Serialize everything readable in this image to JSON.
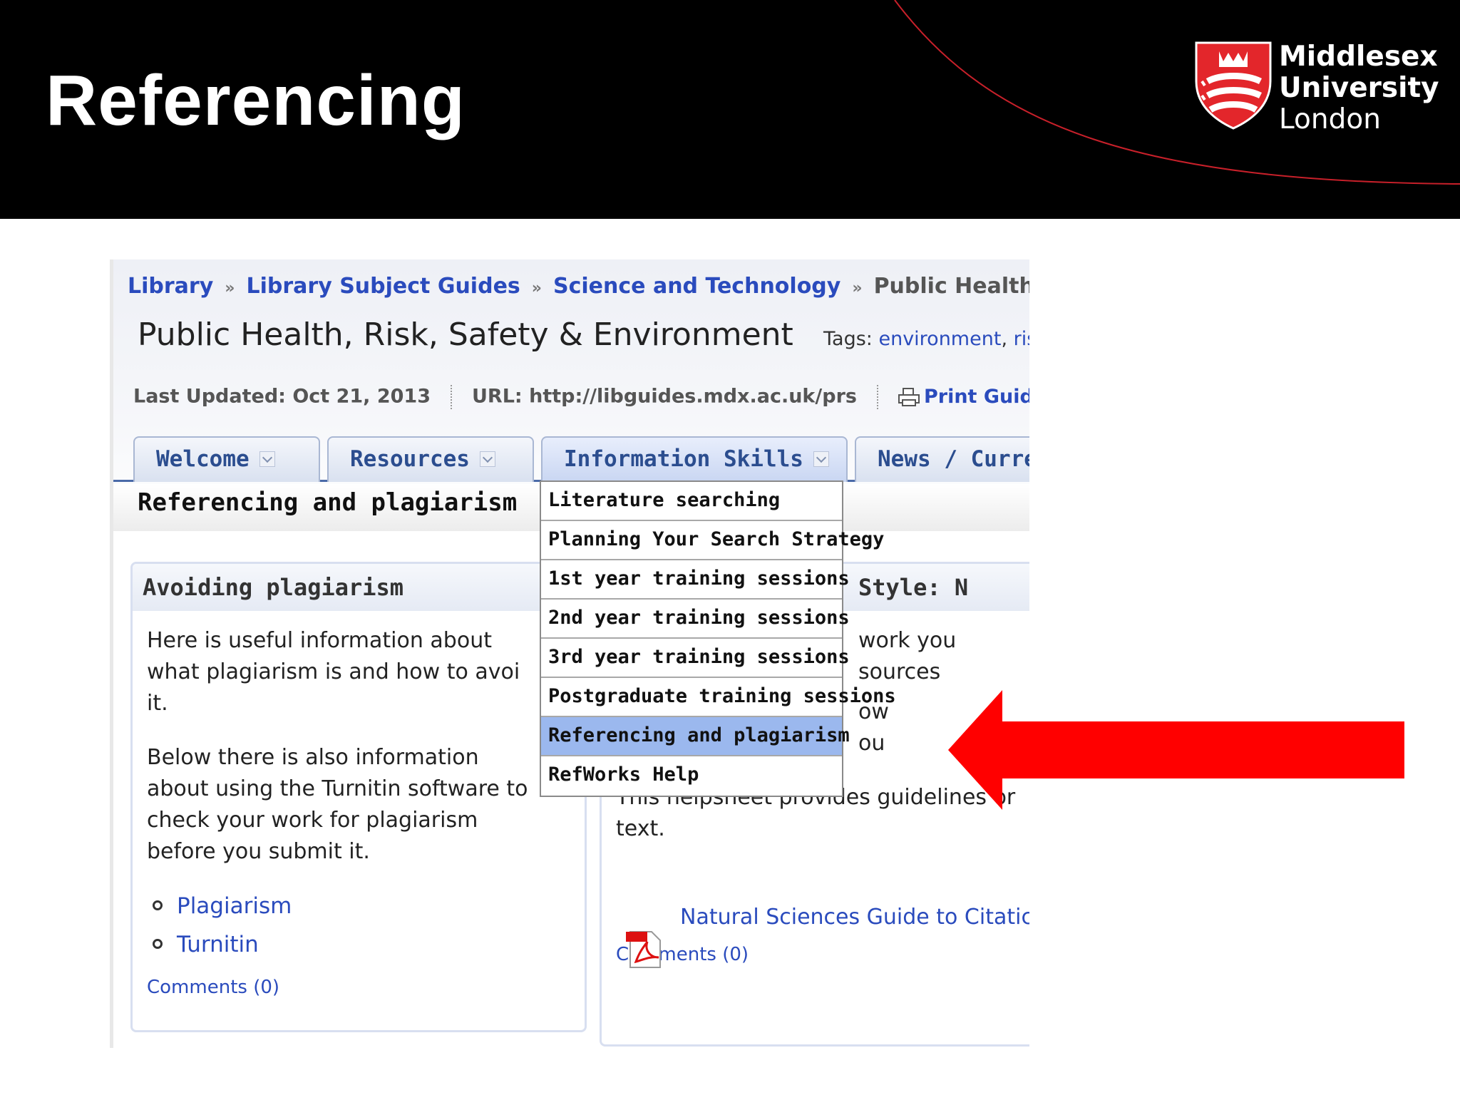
{
  "slide": {
    "title": "Referencing",
    "logo": {
      "line1": "Middlesex",
      "line2": "University",
      "line3": "London"
    }
  },
  "breadcrumb": {
    "items": [
      "Library",
      "Library Subject Guides",
      "Science and Technology"
    ],
    "current": "Public Health, Risk",
    "separator": "»"
  },
  "guide": {
    "title": "Public Health, Risk, Safety & Environment",
    "tags_label": "Tags:",
    "tags": [
      "environment",
      "ris"
    ]
  },
  "meta": {
    "last_updated": "Last Updated: Oct 21, 2013",
    "url": "URL: http://libguides.mdx.ac.uk/prs",
    "print": "Print Guide"
  },
  "tabs": [
    {
      "label": "Welcome"
    },
    {
      "label": "Resources"
    },
    {
      "label": "Information Skills"
    },
    {
      "label": "News / Curre"
    }
  ],
  "page_heading": "Referencing and plagiarism",
  "dropdown": {
    "items": [
      "Literature searching",
      "Planning Your Search Strategy",
      "1st year training sessions",
      "2nd year training sessions",
      "3rd year training sessions",
      "Postgraduate training sessions",
      "Referencing and plagiarism",
      "RefWorks Help"
    ],
    "selected": "Referencing and plagiarism"
  },
  "left_box": {
    "header": "Avoiding plagiarism",
    "para1": [
      "Here is useful information about",
      "what plagiarism is and how to avoi",
      "it."
    ],
    "para2": [
      "Below there is also information",
      "about using the Turnitin software to",
      "check your work for plagiarism",
      "before you submit it."
    ],
    "links": [
      "Plagiarism",
      "Turnitin"
    ],
    "comments": "Comments (0)"
  },
  "right_box": {
    "header": "Style: N",
    "lines": [
      "work you",
      "sources",
      "ow",
      "ou",
      "This helpsheet provides guidelines or",
      "text."
    ],
    "pdf_link": "Natural Sciences Guide to Citatic",
    "comments": "Comments (0)"
  },
  "colors": {
    "header_bg": "#000000",
    "link": "#2a4bbd",
    "arrow": "#ff0000",
    "highlight": "#9bb8ee",
    "shield_red": "#e3262b"
  }
}
